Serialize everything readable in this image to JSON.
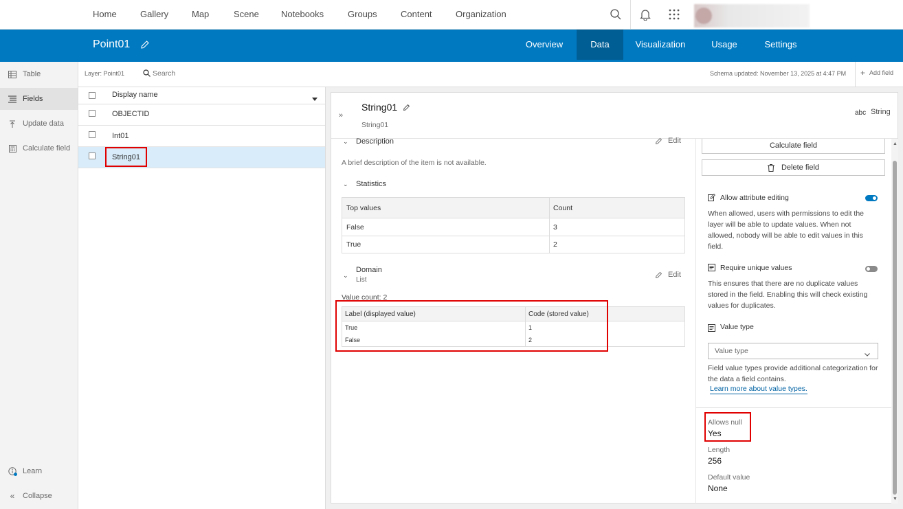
{
  "topnav": {
    "links": [
      "Home",
      "Gallery",
      "Map",
      "Scene",
      "Notebooks",
      "Groups",
      "Content",
      "Organization"
    ]
  },
  "header": {
    "title": "Point01",
    "tabs": [
      "Overview",
      "Data",
      "Visualization",
      "Usage",
      "Settings"
    ],
    "active_tab": "Data",
    "accent_color": "#0079c1"
  },
  "sidebar": {
    "items": [
      "Table",
      "Fields",
      "Update data",
      "Calculate field"
    ],
    "active": "Fields",
    "learn": "Learn",
    "collapse": "Collapse"
  },
  "toolbar": {
    "layer": "Layer: Point01",
    "search_placeholder": "Search",
    "schema_updated": "Schema updated: November 13, 2025 at 4:47 PM",
    "add_field": "Add field"
  },
  "field_list": {
    "header": "Display name",
    "rows": [
      "OBJECTID",
      "Int01",
      "String01"
    ],
    "selected": "String01"
  },
  "detail": {
    "title": "String01",
    "subtitle": "String01",
    "type_icon": "abc",
    "type": "String",
    "description": {
      "title": "Description",
      "edit": "Edit",
      "text": "A brief description of the item is not available."
    },
    "statistics": {
      "title": "Statistics",
      "headers": [
        "Top values",
        "Count"
      ],
      "rows": [
        [
          "False",
          "3"
        ],
        [
          "True",
          "2"
        ]
      ]
    },
    "domain": {
      "title": "Domain",
      "subtitle": "List",
      "edit": "Edit",
      "value_count": "Value count: 2",
      "headers": [
        "Label (displayed value)",
        "Code (stored value)"
      ],
      "rows": [
        [
          "True",
          "1"
        ],
        [
          "False",
          "2"
        ]
      ]
    }
  },
  "right_panel": {
    "calculate_field": "Calculate field",
    "delete_field": "Delete field",
    "allow_editing": {
      "label": "Allow attribute editing",
      "enabled": true,
      "description": "When allowed, users with permissions to edit the layer will be able to update values. When not allowed, nobody will be able to edit values in this field."
    },
    "require_unique": {
      "label": "Require unique values",
      "enabled": false,
      "description": "This ensures that there are no duplicate values stored in the field. Enabling this will check existing values for duplicates."
    },
    "value_type": {
      "label": "Value type",
      "placeholder": "Value type",
      "description": "Field value types provide additional categorization for the data a field contains.",
      "link": "Learn more about value types."
    },
    "properties": [
      {
        "label": "Allows null",
        "value": "Yes"
      },
      {
        "label": "Length",
        "value": "256"
      },
      {
        "label": "Default value",
        "value": "None"
      }
    ]
  }
}
